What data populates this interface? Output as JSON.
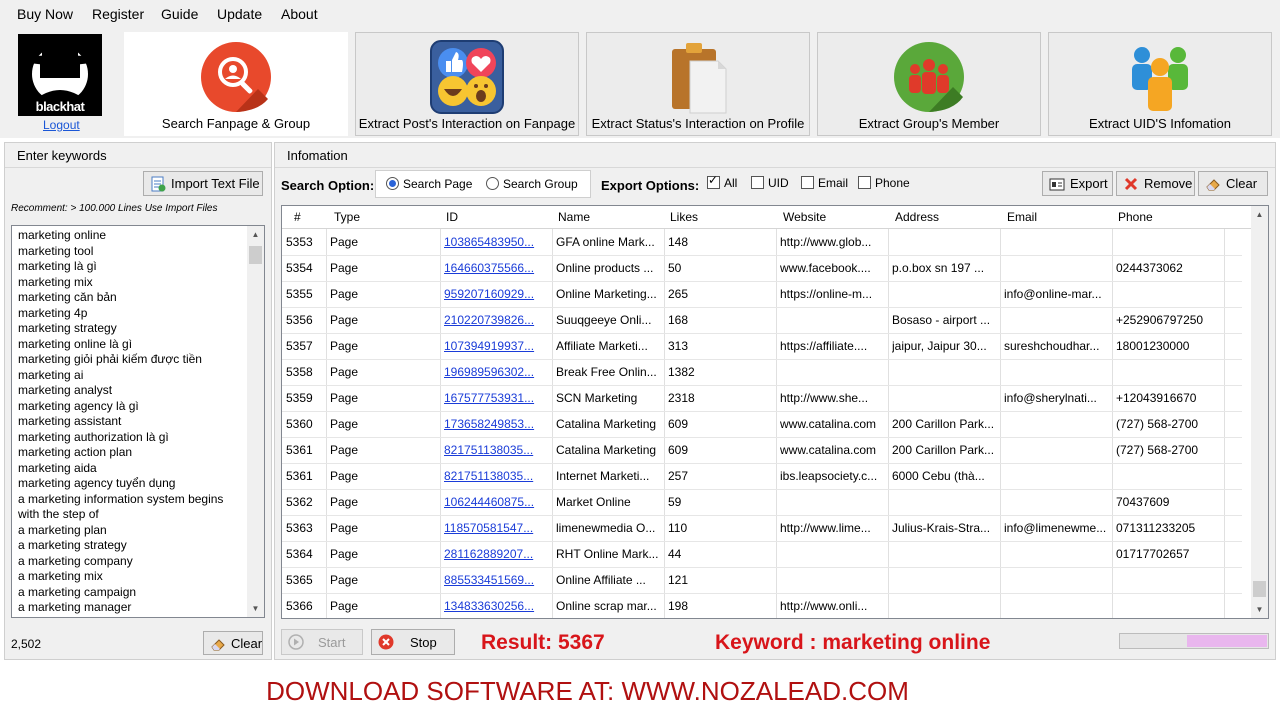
{
  "menu": [
    "Buy Now",
    "Register",
    "Guide",
    "Update",
    "About"
  ],
  "logo": {
    "text": "blackhat",
    "logout": "Logout"
  },
  "toolbar": [
    {
      "label": "Search Fanpage & Group",
      "icon": "search-user-icon",
      "active": true
    },
    {
      "label": "Extract Post's Interaction on Fanpage",
      "icon": "reactions-icon",
      "active": false
    },
    {
      "label": "Extract Status's Interaction on Profile",
      "icon": "clipboard-icon",
      "active": false
    },
    {
      "label": "Extract Group's Member",
      "icon": "group-icon",
      "active": false
    },
    {
      "label": "Extract UID'S  Infomation",
      "icon": "users-icon",
      "active": false
    }
  ],
  "left": {
    "title": "Enter keywords",
    "import_label": "Import Text File",
    "recommend": "Recomment: > 100.000 Lines Use Import Files",
    "keywords": [
      "marketing online",
      "marketing tool",
      "marketing là gì",
      "marketing mix",
      "marketing căn bản",
      "marketing 4p",
      "marketing strategy",
      "marketing online là gì",
      "marketing giỏi phải kiếm được tiền",
      "marketing ai",
      "marketing analyst",
      "marketing agency là gì",
      "marketing assistant",
      "marketing authorization là gì",
      "marketing action plan",
      "marketing aida",
      "marketing agency tuyển dụng",
      "a marketing information system begins",
      "with the step of",
      "a marketing plan",
      "a marketing strategy",
      "a marketing company",
      "a marketing mix",
      "a marketing campaign",
      "a marketing manager"
    ],
    "count": "2,502",
    "clear_label": "Clear"
  },
  "right": {
    "title": "Infomation",
    "search_option_label": "Search Option:",
    "search_page": "Search Page",
    "search_group": "Search Group",
    "search_selected": "page",
    "export_options_label": "Export Options:",
    "checks": [
      {
        "label": "All",
        "checked": true
      },
      {
        "label": "UID",
        "checked": false
      },
      {
        "label": "Email",
        "checked": false
      },
      {
        "label": "Phone",
        "checked": false
      }
    ],
    "export_label": "Export",
    "remove_label": "Remove",
    "clear_label": "Clear",
    "columns": [
      "#",
      "Type",
      "ID",
      "Name",
      "Likes",
      "Website",
      "Address",
      "Email",
      "Phone"
    ],
    "rows": [
      [
        "5353",
        "Page",
        "103865483950...",
        "GFA online Mark...",
        "148",
        "http://www.glob...",
        "",
        "",
        ""
      ],
      [
        "5354",
        "Page",
        "164660375566...",
        "Online products ...",
        "50",
        "www.facebook....",
        "p.o.box sn 197 ...",
        "",
        "0244373062"
      ],
      [
        "5355",
        "Page",
        "959207160929...",
        "Online Marketing...",
        "265",
        "https://online-m...",
        "",
        "info@online-mar...",
        ""
      ],
      [
        "5356",
        "Page",
        "210220739826...",
        "Suuqgeeye Onli...",
        "168",
        "",
        "Bosaso - airport ...",
        "",
        "+252906797250"
      ],
      [
        "5357",
        "Page",
        "107394919937...",
        "Affiliate Marketi...",
        "313",
        "https://affiliate....",
        "jaipur, Jaipur 30...",
        "sureshchoudhar...",
        "18001230000"
      ],
      [
        "5358",
        "Page",
        "196989596302...",
        "Break Free Onlin...",
        "1382",
        "",
        "",
        "",
        ""
      ],
      [
        "5359",
        "Page",
        "167577753931...",
        "SCN Marketing",
        "2318",
        "http://www.she...",
        "",
        "info@sherylnati...",
        "+12043916670"
      ],
      [
        "5360",
        "Page",
        "173658249853...",
        "Catalina Marketing",
        "609",
        "www.catalina.com",
        "200 Carillon Park...",
        "",
        "(727) 568-2700"
      ],
      [
        "5361",
        "Page",
        "821751138035...",
        "Catalina Marketing",
        "609",
        "www.catalina.com",
        "200 Carillon Park...",
        "",
        "(727) 568-2700"
      ],
      [
        "5361",
        "Page",
        "821751138035...",
        "Internet Marketi...",
        "257",
        "ibs.leapsociety.c...",
        "6000 Cebu (thà...",
        "",
        ""
      ],
      [
        "5362",
        "Page",
        "106244460875...",
        "Market Online",
        "59",
        "",
        "",
        "",
        "70437609"
      ],
      [
        "5363",
        "Page",
        "118570581547...",
        "limenewmedia O...",
        "110",
        "http://www.lime...",
        "Julius-Krais-Stra...",
        "info@limenewme...",
        "071311233205"
      ],
      [
        "5364",
        "Page",
        "281162889207...",
        "RHT Online Mark...",
        "44",
        "",
        "",
        "",
        "01717702657"
      ],
      [
        "5365",
        "Page",
        "885533451569...",
        "Online Affiliate ...",
        "121",
        "",
        "",
        "",
        ""
      ],
      [
        "5366",
        "Page",
        "134833630256...",
        "Online scrap mar...",
        "198",
        "http://www.onli...",
        "",
        "",
        ""
      ]
    ],
    "start_label": "Start",
    "stop_label": "Stop",
    "result_text": "Result:  5367",
    "keyword_text": "Keyword :   marketing online",
    "progress_fraction": 0.55
  },
  "footer": "DOWNLOAD SOFTWARE AT: WWW.NOZALEAD.COM",
  "colors": {
    "accent_red": "#d8151a",
    "link_blue": "#1a3cd8",
    "footer_red": "#b01010"
  }
}
